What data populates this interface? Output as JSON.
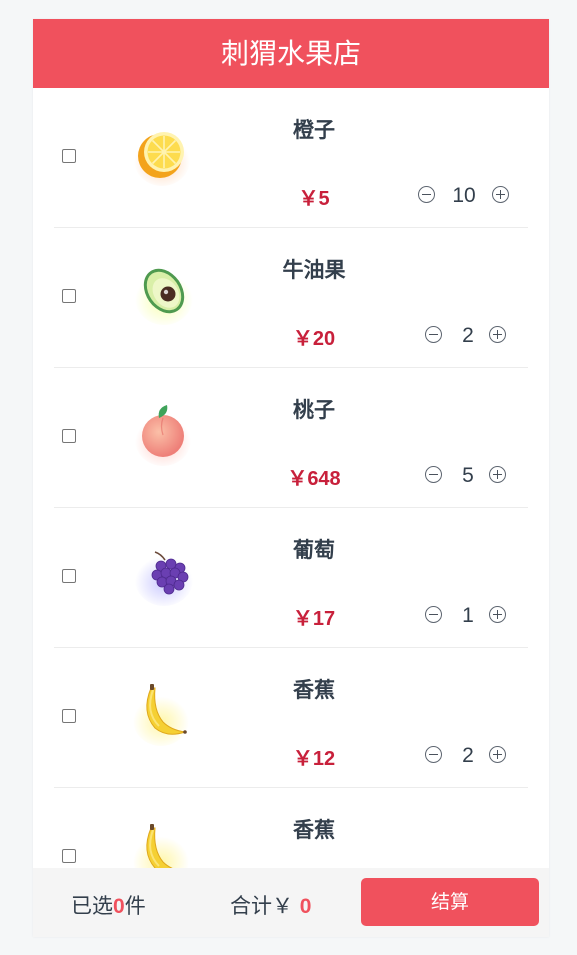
{
  "header": {
    "title": "刺猬水果店"
  },
  "currency": "￥",
  "items": [
    {
      "name": "橙子",
      "price": "5",
      "qty": "10",
      "fruit": "orange-icon"
    },
    {
      "name": "牛油果",
      "price": "20",
      "qty": "2",
      "fruit": "avocado-icon"
    },
    {
      "name": "桃子",
      "price": "648",
      "qty": "5",
      "fruit": "peach-icon"
    },
    {
      "name": "葡萄",
      "price": "17",
      "qty": "1",
      "fruit": "grape-icon"
    },
    {
      "name": "香蕉",
      "price": "12",
      "qty": "2",
      "fruit": "banana-icon"
    },
    {
      "name": "香蕉",
      "price": "",
      "qty": "",
      "fruit": "banana-icon"
    }
  ],
  "footer": {
    "selected_prefix": "已选",
    "selected_count": "0",
    "selected_suffix": "件",
    "total_label": "合计￥",
    "total_value": "0",
    "checkout_label": "结算"
  },
  "colors": {
    "accent": "#f0515d",
    "price": "#c8203b",
    "text": "#333f4c"
  }
}
